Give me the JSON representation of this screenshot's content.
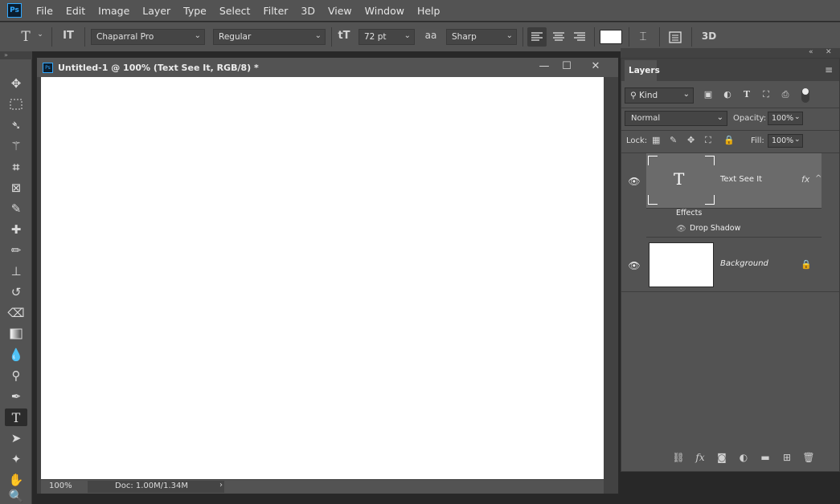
{
  "app": {
    "logo": "Ps",
    "menu": [
      "File",
      "Edit",
      "Image",
      "Layer",
      "Type",
      "Select",
      "Filter",
      "3D",
      "View",
      "Window",
      "Help"
    ]
  },
  "options": {
    "type_tool_icon": "T",
    "orientation_icon": "IT",
    "font_family": "Chaparral Pro",
    "font_style": "Regular",
    "size_icon": "tT",
    "font_size": "72 pt",
    "aa_icon": "aa",
    "antialias": "Sharp",
    "color_swatch": "#ffffff",
    "three_d": "3D"
  },
  "document": {
    "logo": "Ps",
    "title": "Untitled-1 @ 100% (Text See It, RGB/8) *",
    "zoom": "100%",
    "doc_info": "Doc: 1.00M/1.34M",
    "canvas_color": "#ffffff"
  },
  "layers_panel": {
    "tab": "Layers",
    "kind": "Kind",
    "blend_mode": "Normal",
    "opacity_label": "Opacity:",
    "opacity": "100%",
    "lock_label": "Lock:",
    "fill_label": "Fill:",
    "fill": "100%",
    "layers": [
      {
        "name": "Text See It",
        "type": "text",
        "selected": true,
        "fx": "fx",
        "thumb_glyph": "T"
      },
      {
        "name": "Background",
        "type": "background",
        "locked": true
      }
    ],
    "effects_label": "Effects",
    "effect_name": "Drop Shadow"
  }
}
